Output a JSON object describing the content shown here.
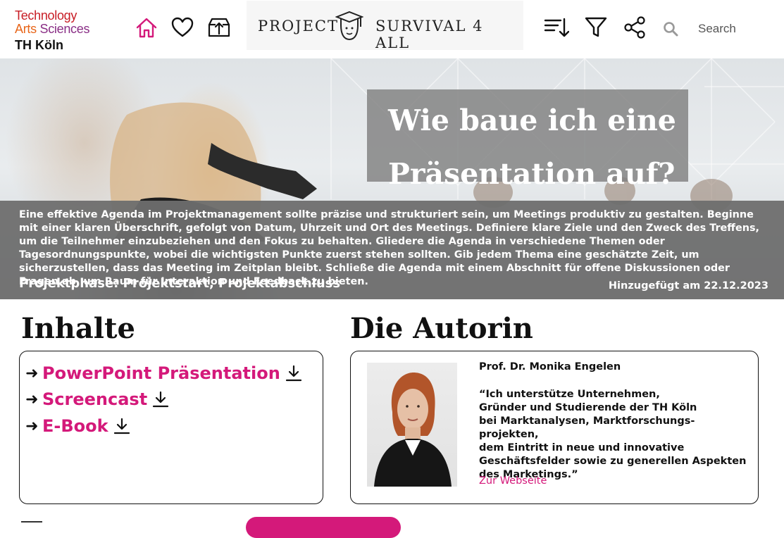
{
  "logo": {
    "line1": "Technology",
    "line2a": "Arts",
    "line2b": "Sciences",
    "line3": "TH Köln"
  },
  "nav": {
    "icons": [
      "home-icon",
      "heart-icon",
      "upload-box-icon"
    ]
  },
  "banner": {
    "word1": "PROJECT",
    "word2": "SURVIVAL 4 ALL"
  },
  "toolbar": {
    "icons": [
      "sort-icon",
      "filter-icon",
      "share-icon"
    ]
  },
  "search": {
    "placeholder": "Search"
  },
  "hero": {
    "title": "Wie baue ich eine Präsentation auf?",
    "description": "Eine effektive Agenda im Projektmanagement sollte präzise und strukturiert sein, um Meetings produktiv zu gestalten. Beginne mit einer klaren Überschrift, gefolgt von Datum, Uhrzeit und Ort des Meetings. Definiere klare Ziele und den Zweck des Treffens, um die Teilnehmer einzubeziehen und den Fokus zu behalten. Gliedere die Agenda in verschiedene Themen oder Tagesordnungspunkte, wobei die wichtigsten Punkte zuerst stehen sollten. Gib jedem Thema eine geschätzte Zeit, um sicherzustellen, dass das Meeting im Zeitplan bleibt. Schließe die Agenda mit einem Abschnitt für offene Diskussionen oder Fragen ab, um Raum für Interaktion und Feedback zu bieten.",
    "phase": "Projektphase: Projektstart, Projektabschluss",
    "added": "Hinzugefügt am 22.12.2023"
  },
  "contents": {
    "heading": "Inhalte",
    "items": [
      {
        "label": "PowerPoint Präsentation"
      },
      {
        "label": "Screencast"
      },
      {
        "label": "E-Book"
      }
    ]
  },
  "author": {
    "heading": "Die Autorin",
    "name": "Prof. Dr. Monika Engelen",
    "quote": "“Ich unterstütze Unternehmen,\nGründer und Studierende der TH Köln\nbei Marktanalysen, Marktforschungs-projekten,\ndem Eintritt in neue und innovative\nGeschäftsfelder sowie zu generellen Aspekten\ndes Marketings.”",
    "link": "Zur Webseite"
  },
  "colors": {
    "accent": "#d4197a",
    "home": "#d4197a",
    "overlay": "#6e6e6e"
  }
}
